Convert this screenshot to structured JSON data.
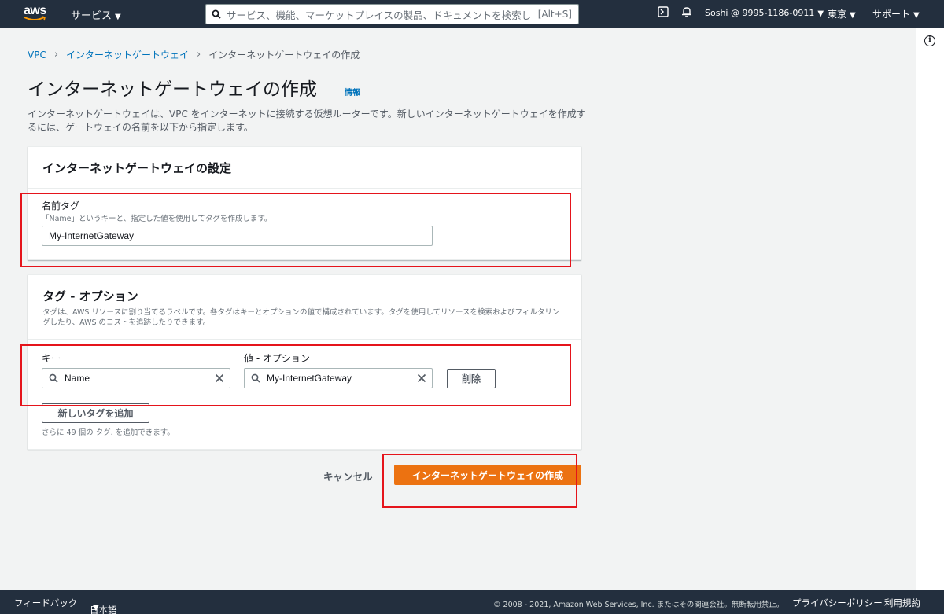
{
  "nav": {
    "logo_text": "aws",
    "services": "サービス",
    "search_placeholder": "サービス、機能、マーケットプレイスの製品、ドキュメントを検索し",
    "search_shortcut": "[Alt+S]",
    "account": "Soshi @ 9995-1186-0911",
    "region": "東京",
    "support": "サポート"
  },
  "breadcrumb": {
    "item1": "VPC",
    "item2": "インターネットゲートウェイ",
    "current": "インターネットゲートウェイの作成"
  },
  "page": {
    "title": "インターネットゲートウェイの作成",
    "info": "情報",
    "description": "インターネットゲートウェイは、VPC をインターネットに接続する仮想ルーターです。新しいインターネットゲートウェイを作成するには、ゲートウェイの名前を以下から指定します。"
  },
  "settings": {
    "title": "インターネットゲートウェイの設定",
    "name_tag_label": "名前タグ",
    "name_tag_hint": "「Name」というキーと、指定した値を使用してタグを作成します。",
    "name_tag_value": "My-InternetGateway"
  },
  "tags": {
    "title": "タグ - オプション",
    "description": "タグは、AWS リソースに割り当てるラベルです。各タグはキーとオプションの値で構成されています。タグを使用してリソースを検索およびフィルタリングしたり、AWS のコストを追跡したりできます。",
    "key_label": "キー",
    "value_label": "値 - オプション",
    "key_value": "Name",
    "value_value": "My-InternetGateway",
    "remove_button": "削除",
    "add_button": "新しいタグを追加",
    "remaining_note": "さらに 49 個の タグ. を追加できます。"
  },
  "actions": {
    "cancel": "キャンセル",
    "create": "インターネットゲートウェイの作成"
  },
  "footer": {
    "feedback": "フィードバック",
    "language": "日本語",
    "copyright": "© 2008 - 2021, Amazon Web Services, Inc. またはその関連会社。無断転用禁止。",
    "privacy": "プライバシーポリシー",
    "terms": "利用規約"
  },
  "colors": {
    "nav_bg": "#232f3e",
    "primary_button": "#ec7211",
    "link": "#0073bb",
    "annotation": "#e5141b"
  }
}
